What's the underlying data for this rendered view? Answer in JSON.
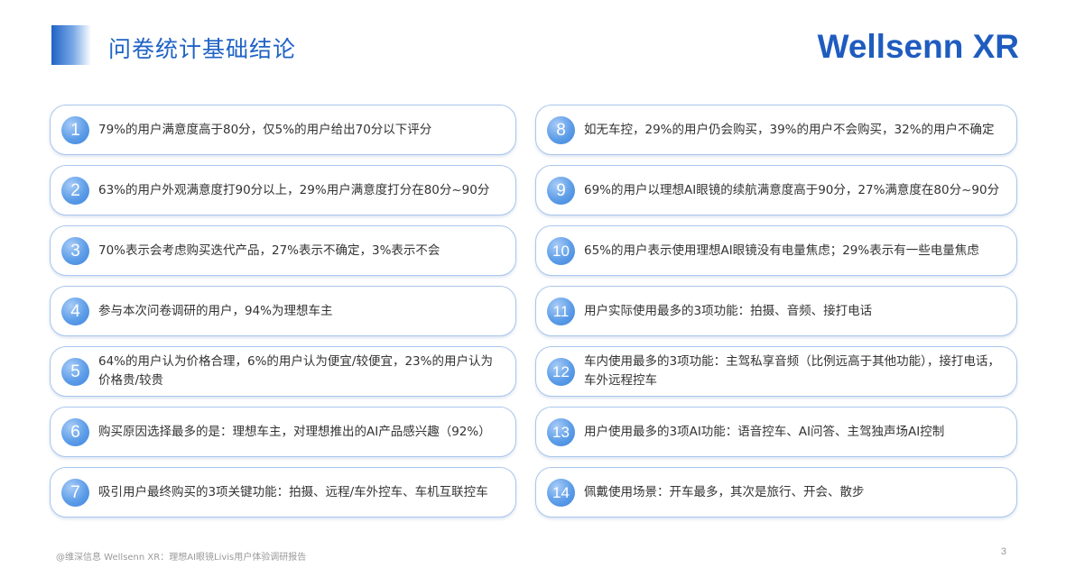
{
  "header": {
    "title": "问卷统计基础结论",
    "logo_text": "Wellsenn XR"
  },
  "conclusions_left": [
    {
      "num": "1",
      "text": "79%的用户满意度高于80分，仅5%的用户给出70分以下评分"
    },
    {
      "num": "2",
      "text": "63%的用户外观满意度打90分以上，29%用户满意度打分在80分~90分"
    },
    {
      "num": "3",
      "text": "70%表示会考虑购买迭代产品，27%表示不确定，3%表示不会"
    },
    {
      "num": "4",
      "text": "参与本次问卷调研的用户，94%为理想车主"
    },
    {
      "num": "5",
      "text": "64%的用户认为价格合理，6%的用户认为便宜/较便宜，23%的用户认为价格贵/较贵"
    },
    {
      "num": "6",
      "text": "购买原因选择最多的是：理想车主，对理想推出的AI产品感兴趣（92%）"
    },
    {
      "num": "7",
      "text": "吸引用户最终购买的3项关键功能：拍摄、远程/车外控车、车机互联控车"
    }
  ],
  "conclusions_right": [
    {
      "num": "8",
      "text": "如无车控，29%的用户仍会购买，39%的用户不会购买，32%的用户不确定"
    },
    {
      "num": "9",
      "text": "69%的用户以理想AI眼镜的续航满意度高于90分，27%满意度在80分~90分"
    },
    {
      "num": "10",
      "text": "65%的用户表示使用理想AI眼镜没有电量焦虑；29%表示有一些电量焦虑"
    },
    {
      "num": "11",
      "text": "用户实际使用最多的3项功能：拍摄、音频、接打电话"
    },
    {
      "num": "12",
      "text": "车内使用最多的3项功能：主驾私享音频（比例远高于其他功能），接打电话，车外远程控车"
    },
    {
      "num": "13",
      "text": "用户使用最多的3项AI功能：语音控车、AI问答、主驾独声场AI控制"
    },
    {
      "num": "14",
      "text": "佩戴使用场景：开车最多，其次是旅行、开会、散步"
    }
  ],
  "footer": {
    "source": "@维深信息 Wellsenn XR：理想AI眼镜Livis用户体验调研报告",
    "page_number": "3"
  },
  "colors": {
    "accent": "#1f63c6",
    "card_border": "#a9c6ec",
    "number_circle": "#5d9de8"
  }
}
